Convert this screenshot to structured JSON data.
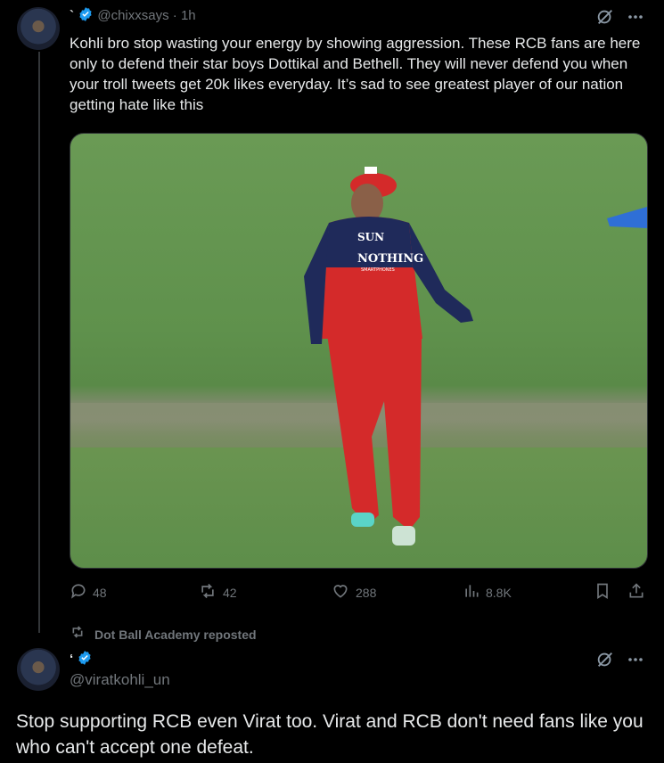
{
  "tweet1": {
    "display_name": "`",
    "handle": "@chixxsays",
    "separator": "·",
    "time": "1h",
    "text": "Kohli bro stop wasting your energy by showing aggression. These RCB fans are here only to defend their star boys Dottikal and Bethell. They will never defend you when your troll tweets get 20k likes everyday. It’s sad to see greatest player of our nation getting hate like this",
    "media": {
      "jersey_sponsor_top": "SUN",
      "jersey_sponsor_main": "NOTHING",
      "jersey_sponsor_sub": "SMARTPHONES"
    },
    "actions": {
      "replies": "48",
      "reposts": "42",
      "likes": "288",
      "views": "8.8K"
    }
  },
  "repost_label": "Dot Ball Academy reposted",
  "tweet2": {
    "display_name": "‘",
    "handle": "@viratkohli_un",
    "text": "Stop supporting RCB even Virat too. Virat and RCB don't need fans like you who can't accept one defeat."
  },
  "colors": {
    "background": "#000000",
    "text": "#e7e9ea",
    "muted": "#71767b",
    "verified": "#1d9bf0",
    "jersey_red": "#d42a2a",
    "jersey_navy": "#1f2a5a"
  },
  "icons": [
    "verified-badge-icon",
    "grok-icon",
    "more-icon",
    "reply-icon",
    "repost-icon",
    "like-icon",
    "views-icon",
    "bookmark-icon",
    "share-icon"
  ]
}
